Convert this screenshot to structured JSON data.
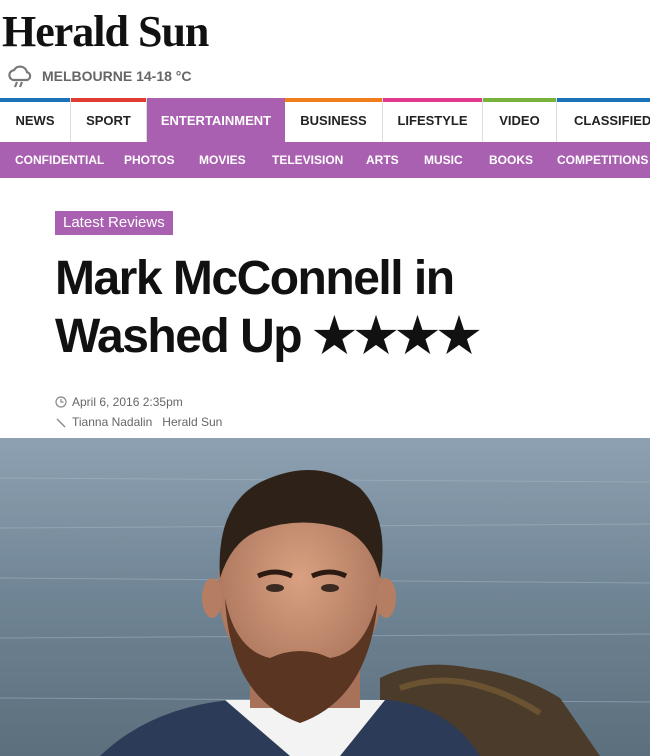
{
  "site": {
    "name": "Herald Sun"
  },
  "weather": {
    "text": "MELBOURNE 14-18 °C",
    "icon": "rain-cloud-icon"
  },
  "nav": {
    "items": [
      {
        "label": "NEWS",
        "color": "#1a73b8"
      },
      {
        "label": "SPORT",
        "color": "#e03c31"
      },
      {
        "label": "ENTERTAINMENT",
        "color": "#a960b0"
      },
      {
        "label": "BUSINESS",
        "color": "#f07d1a"
      },
      {
        "label": "LIFESTYLE",
        "color": "#e0398e"
      },
      {
        "label": "VIDEO",
        "color": "#79b23a"
      },
      {
        "label": "CLASSIFIEDS",
        "color": "#1a73b8"
      }
    ],
    "active": "ENTERTAINMENT"
  },
  "subnav": {
    "items": [
      "CONFIDENTIAL",
      "PHOTOS",
      "MOVIES",
      "TELEVISION",
      "ARTS",
      "MUSIC",
      "BOOKS",
      "COMPETITIONS"
    ]
  },
  "article": {
    "tag": "Latest Reviews",
    "title_line1": "Mark McConnell in",
    "title_line2": "Washed Up ★★★★",
    "date": "April 6, 2016 2:35pm",
    "author": "Tianna Nadalin",
    "publication": "Herald Sun"
  },
  "colors": {
    "accent": "#a960b0"
  }
}
